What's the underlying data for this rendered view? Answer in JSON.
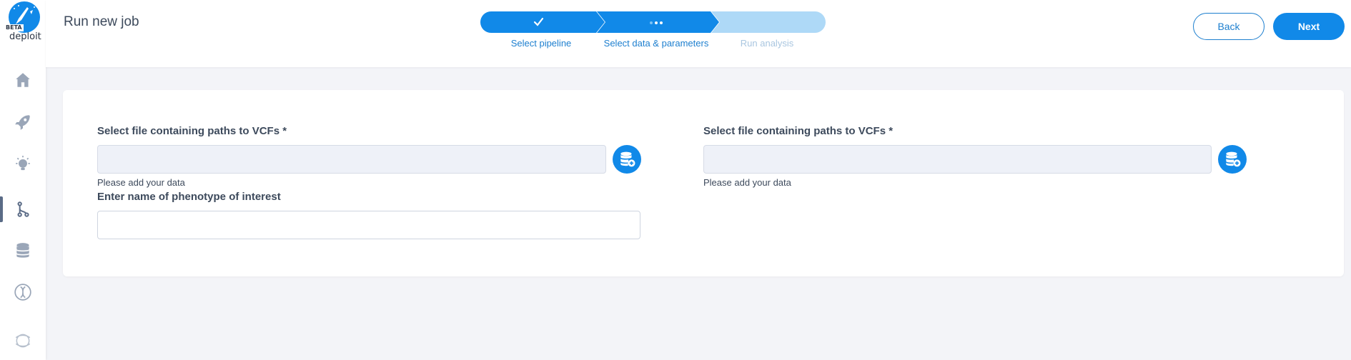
{
  "app": {
    "logo_badge": "BETA",
    "logo_text": "deploit"
  },
  "sidebar": {
    "items": [
      {
        "name": "home",
        "icon": "home-icon"
      },
      {
        "name": "pipelines",
        "icon": "rocket-icon"
      },
      {
        "name": "ideas",
        "icon": "lightbulb-icon"
      },
      {
        "name": "jobs",
        "icon": "branch-icon",
        "active": true
      },
      {
        "name": "data",
        "icon": "database-icon"
      },
      {
        "name": "genomics",
        "icon": "dna-icon"
      },
      {
        "name": "community",
        "icon": "globe-icon"
      }
    ]
  },
  "header": {
    "title": "Run new job",
    "back_label": "Back",
    "next_label": "Next"
  },
  "stepper": {
    "steps": [
      {
        "label": "Select pipeline",
        "state": "completed"
      },
      {
        "label": "Select data & parameters",
        "state": "current"
      },
      {
        "label": "Run analysis",
        "state": "pending"
      }
    ]
  },
  "form": {
    "left": {
      "file_label": "Select file containing paths to VCFs *",
      "file_helper": "Please add your data",
      "text_label": "Enter name of phenotype of interest",
      "text_value": ""
    },
    "right": {
      "file_label": "Select file containing paths to VCFs *",
      "file_helper": "Please add your data"
    }
  },
  "colors": {
    "accent": "#1189e8",
    "stepper_pending": "#aed9f7",
    "label_completed": "#1d7fcf",
    "label_pending": "#a9c6e0"
  }
}
